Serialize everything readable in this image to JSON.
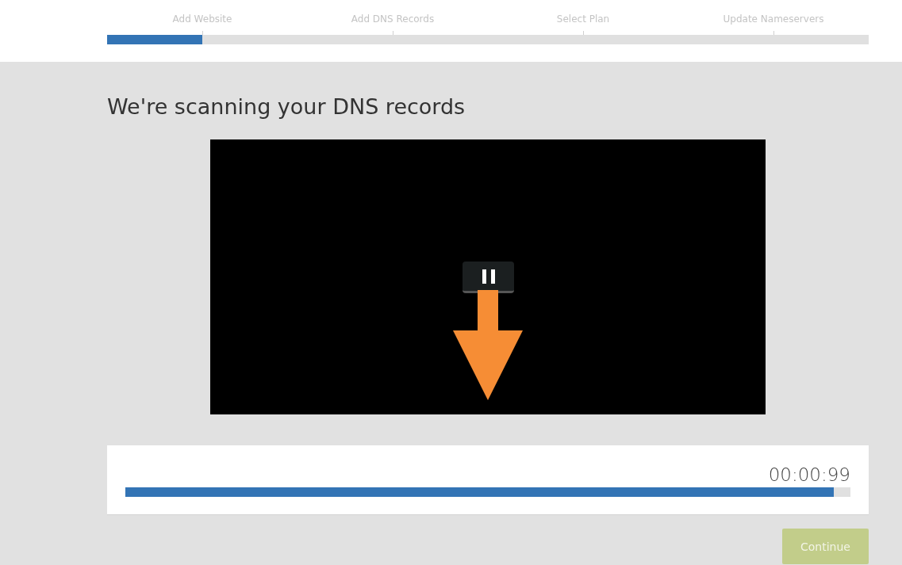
{
  "steps": [
    {
      "label": "Add Website"
    },
    {
      "label": "Add DNS Records"
    },
    {
      "label": "Select Plan"
    },
    {
      "label": "Update Nameservers"
    }
  ],
  "step_progress": {
    "level": 0.125
  },
  "title": "We're scanning your DNS records",
  "video": {
    "playing": true
  },
  "scan": {
    "time": "00:00:99",
    "level": 0.977
  },
  "continue_button": {
    "label": "Continue",
    "disabled": true
  }
}
